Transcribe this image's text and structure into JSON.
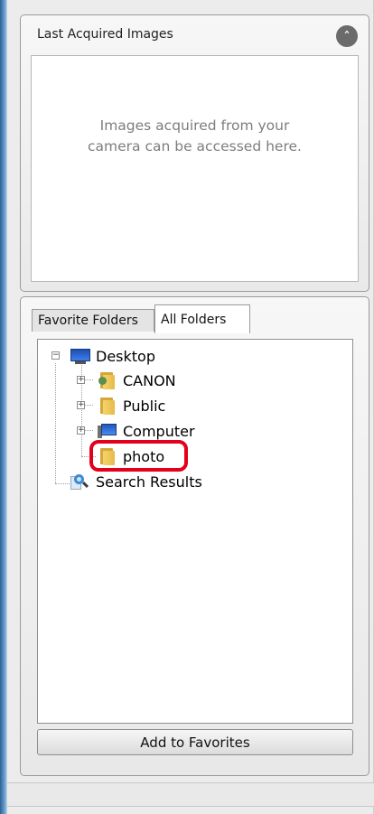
{
  "last_acquired": {
    "title": "Last Acquired Images",
    "collapse_glyph": "˄",
    "message": "Images acquired from your camera can be accessed here."
  },
  "folders": {
    "tabs": [
      {
        "label": "Favorite Folders",
        "selected": false
      },
      {
        "label": "All Folders",
        "selected": true
      }
    ],
    "tree": [
      {
        "label": "Desktop",
        "icon": "desktop-icon",
        "expander": "−"
      },
      {
        "label": "CANON",
        "icon": "user-folder-icon",
        "expander": "+"
      },
      {
        "label": "Public",
        "icon": "folder-icon",
        "expander": "+"
      },
      {
        "label": "Computer",
        "icon": "computer-icon",
        "expander": "+"
      },
      {
        "label": "photo",
        "icon": "folder-icon",
        "highlighted": true
      },
      {
        "label": "Search Results",
        "icon": "search-results-icon"
      }
    ],
    "add_button": "Add to Favorites"
  },
  "colors": {
    "highlight": "#e4001a",
    "window_border": "#4f86bd"
  }
}
